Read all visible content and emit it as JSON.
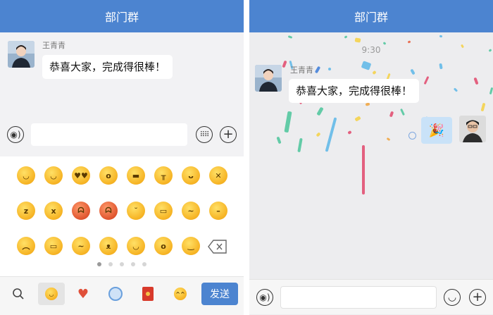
{
  "left": {
    "title": "部门群",
    "message": {
      "sender": "王青青",
      "text": "恭喜大家，完成得很棒！"
    },
    "send_label": "发送",
    "page_dots": 5,
    "active_dot": 0,
    "emoji_rows": [
      [
        "smile",
        "blush",
        "heart-eyes",
        "surprised",
        "cool",
        "crying",
        "yum",
        "mouth-taped"
      ],
      [
        "sleepy",
        "dizzy",
        "angry-red",
        "furious",
        "wink",
        "grin",
        "thinking",
        "neutral"
      ],
      [
        "sad",
        "laughing",
        "sick",
        "shushing",
        "content",
        "cold-sweat",
        "smirk",
        "backspace"
      ]
    ],
    "tabs": [
      "search-icon",
      "emoji-tab-icon",
      "heart-tab-icon",
      "sticker-tab-icon",
      "red-packet-icon",
      "sweat-smile-tab-icon"
    ]
  },
  "right": {
    "title": "部门群",
    "time": "9:30",
    "message": {
      "sender": "王青青",
      "text": "恭喜大家，完成得很棒！"
    },
    "sent_emoji": "🎉"
  },
  "colors": {
    "brand": "#4c84d0"
  }
}
